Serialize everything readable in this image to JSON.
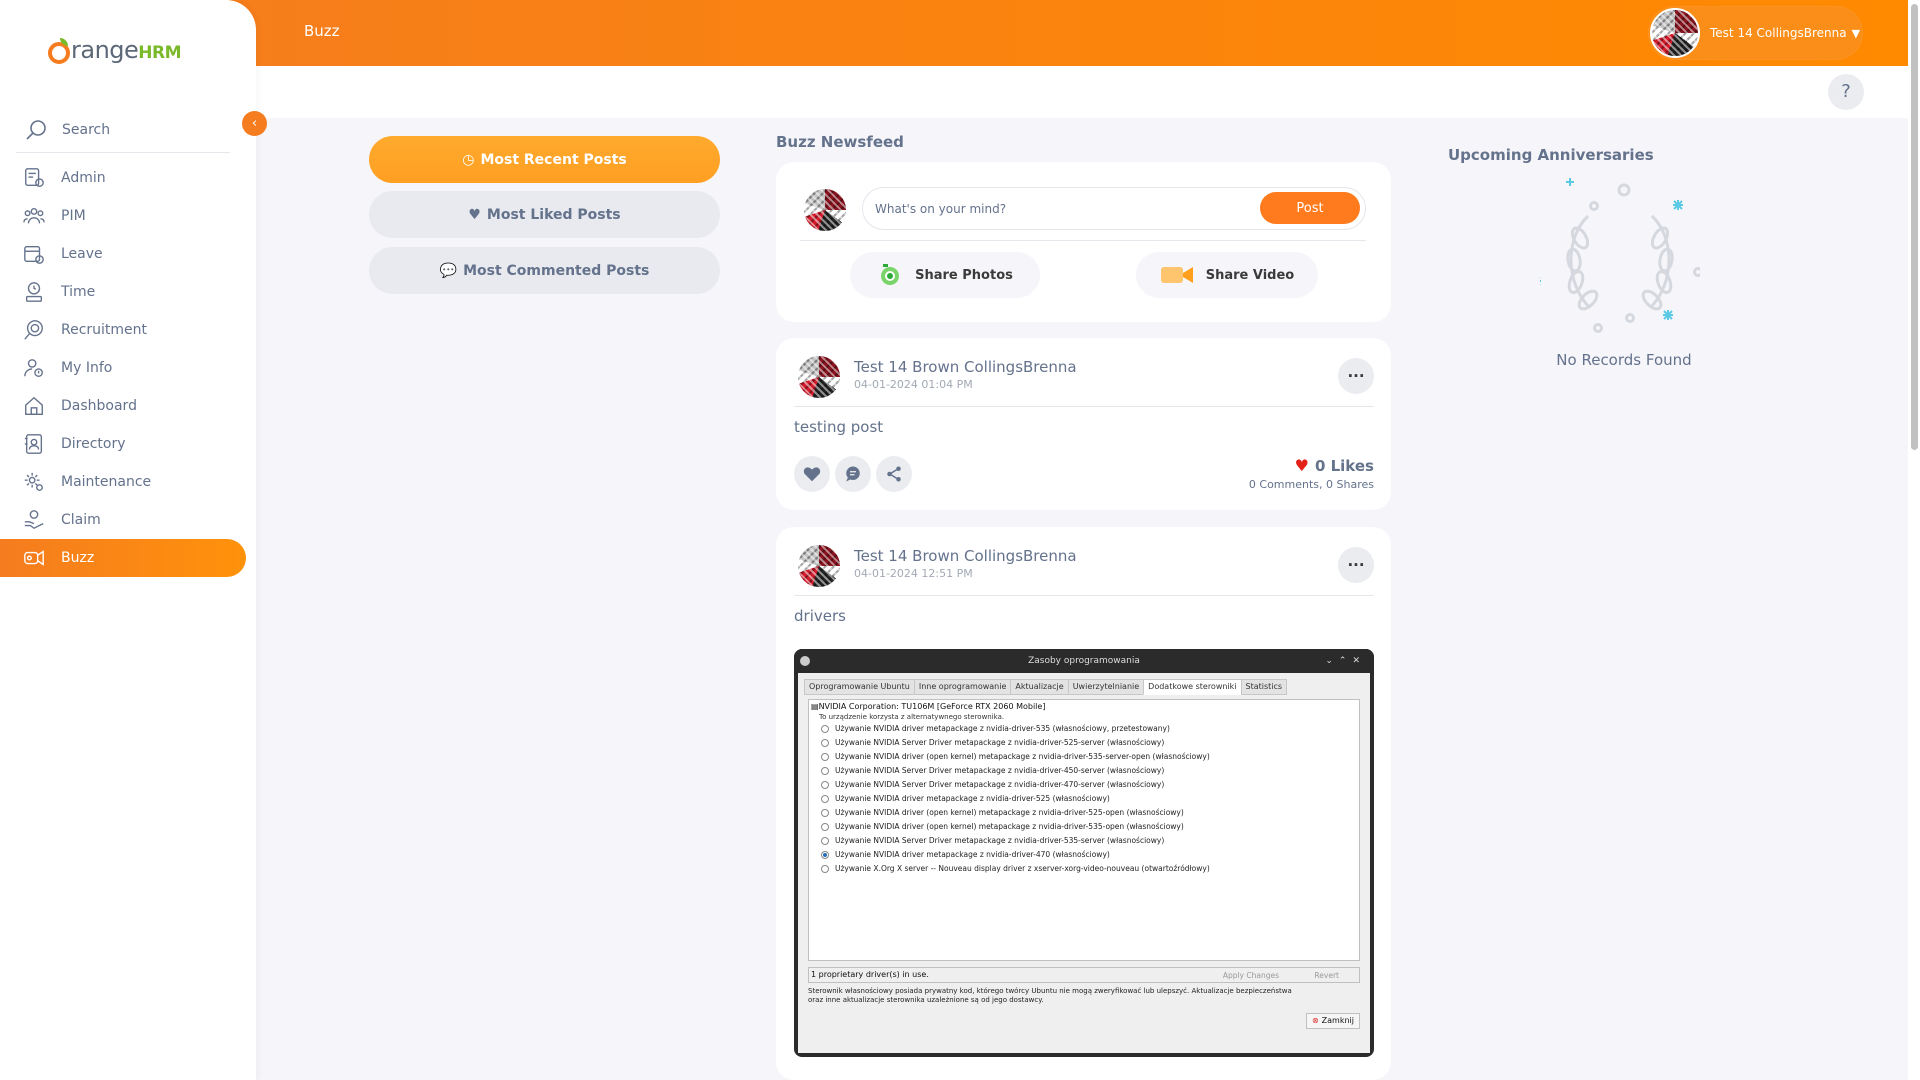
{
  "app": {
    "brand_main": "range",
    "brand_suffix": "HRM",
    "page_title": "Buzz",
    "user_name": "Test 14 CollingsBrenna",
    "collapse_glyph": "‹",
    "help_glyph": "?"
  },
  "sidebar": {
    "search_label": "Search",
    "items": [
      {
        "label": "Admin",
        "icon": "admin-icon"
      },
      {
        "label": "PIM",
        "icon": "pim-icon"
      },
      {
        "label": "Leave",
        "icon": "leave-icon"
      },
      {
        "label": "Time",
        "icon": "time-icon"
      },
      {
        "label": "Recruitment",
        "icon": "recruitment-icon"
      },
      {
        "label": "My Info",
        "icon": "my-info-icon"
      },
      {
        "label": "Dashboard",
        "icon": "dashboard-icon"
      },
      {
        "label": "Directory",
        "icon": "directory-icon"
      },
      {
        "label": "Maintenance",
        "icon": "maintenance-icon"
      },
      {
        "label": "Claim",
        "icon": "claim-icon"
      },
      {
        "label": "Buzz",
        "icon": "buzz-icon",
        "active": true
      }
    ]
  },
  "filters": {
    "most_recent": "Most Recent Posts",
    "most_liked": "Most Liked Posts",
    "most_commented": "Most Commented Posts"
  },
  "feed": {
    "title": "Buzz Newsfeed",
    "composer": {
      "placeholder": "What's on your mind?",
      "post_label": "Post",
      "share_photos": "Share Photos",
      "share_video": "Share Video"
    },
    "posts": [
      {
        "author": "Test 14 Brown CollingsBrenna",
        "date": "04-01-2024 01:04 PM",
        "text": "testing post",
        "likes": "0 Likes",
        "comments": "0 Comments",
        "shares": "0 Shares"
      },
      {
        "author": "Test 14 Brown CollingsBrenna",
        "date": "04-01-2024 12:51 PM",
        "text": "drivers",
        "attachment": {
          "window_title": "Zasoby oprogramowania",
          "tabs": [
            "Oprogramowanie Ubuntu",
            "Inne oprogramowanie",
            "Aktualizacje",
            "Uwierzytelnianie",
            "Dodatkowe sterowniki",
            "Statistics"
          ],
          "selected_tab": "Dodatkowe sterowniki",
          "device": "NVIDIA Corporation: TU106M [GeForce RTX 2060 Mobile]",
          "device_sub": "To urządzenie korzysta z alternatywnego sterownika.",
          "options": [
            "Używanie NVIDIA driver metapackage z nvidia-driver-535 (własnościowy, przetestowany)",
            "Używanie NVIDIA Server Driver metapackage z nvidia-driver-525-server (własnościowy)",
            "Używanie NVIDIA driver (open kernel) metapackage z nvidia-driver-535-server-open (własnościowy)",
            "Używanie NVIDIA Server Driver metapackage z nvidia-driver-450-server (własnościowy)",
            "Używanie NVIDIA Server Driver metapackage z nvidia-driver-470-server (własnościowy)",
            "Używanie NVIDIA driver metapackage z nvidia-driver-525 (własnościowy)",
            "Używanie NVIDIA driver (open kernel) metapackage z nvidia-driver-525-open (własnościowy)",
            "Używanie NVIDIA driver (open kernel) metapackage z nvidia-driver-535-open (własnościowy)",
            "Używanie NVIDIA Server Driver metapackage z nvidia-driver-535-server (własnościowy)",
            "Używanie NVIDIA driver metapackage z nvidia-driver-470 (własnościowy)",
            "Używanie X.Org X server -- Nouveau display driver z xserver-xorg-video-nouveau (otwartoźródłowy)"
          ],
          "selected_option_index": 9,
          "status": "1 proprietary driver(s) in use.",
          "apply_label": "Apply Changes",
          "revert_label": "Revert",
          "note": "Sterownik własnościowy posiada prywatny kod, którego twórcy Ubuntu nie mogą zweryfikować lub ulepszyć. Aktualizacje bezpieczeństwa oraz inne aktualizacje sterownika uzależnione są od jego dostawcy.",
          "close_label": "Zamknij"
        }
      }
    ]
  },
  "anniversaries": {
    "title": "Upcoming Anniversaries",
    "empty_text": "No Records Found"
  },
  "colors": {
    "brand_orange": "#f57c1f",
    "brand_green": "#7ab929",
    "like_red": "#e32119",
    "text": "#64728c"
  }
}
